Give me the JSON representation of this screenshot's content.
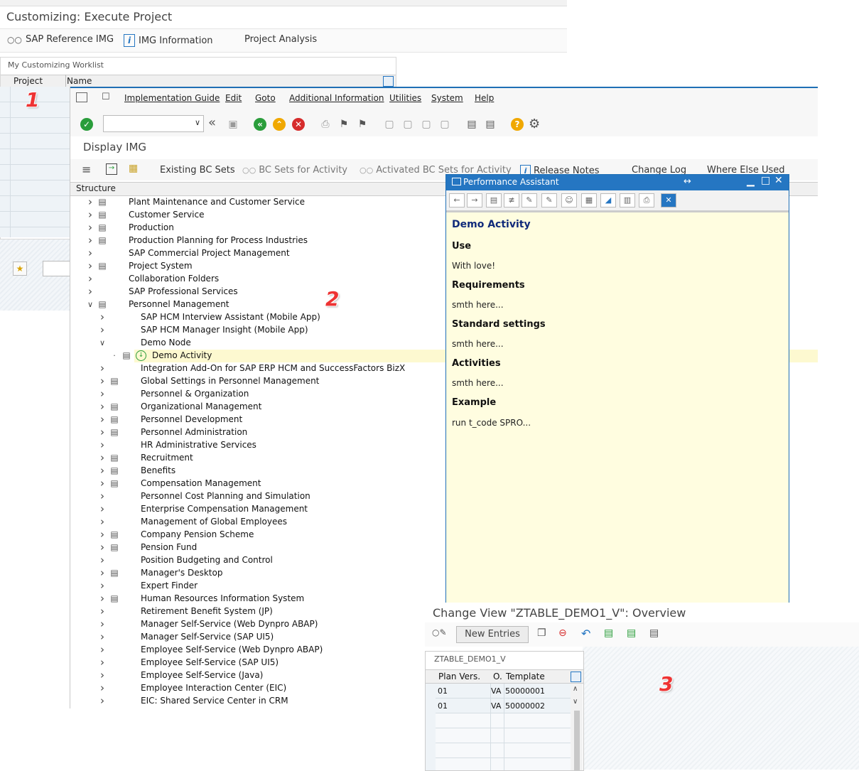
{
  "back_window": {
    "title": "Customizing: Execute Project",
    "app_buttons": [
      "SAP Reference IMG",
      "IMG Information",
      "Project Analysis"
    ],
    "worklist_caption": "My Customizing Worklist",
    "columns": [
      "Project",
      "Name"
    ]
  },
  "annotations": [
    "1",
    "2",
    "3"
  ],
  "img_window": {
    "menu": [
      "Implementation Guide",
      "Edit",
      "Goto",
      "Additional Information",
      "Utilities",
      "System",
      "Help"
    ],
    "title": "Display IMG",
    "app_buttons": [
      "Existing BC Sets",
      "BC Sets for Activity",
      "Activated BC Sets for Activity",
      "Release Notes",
      "Change Log",
      "Where Else Used"
    ],
    "structure_label": "Structure",
    "tree": [
      {
        "label": "Plant Maintenance and Customer Service",
        "level": 0,
        "doc": true,
        "chev": "right"
      },
      {
        "label": "Customer Service",
        "level": 0,
        "doc": true,
        "chev": "right"
      },
      {
        "label": "Production",
        "level": 0,
        "doc": true,
        "chev": "right"
      },
      {
        "label": "Production Planning for Process Industries",
        "level": 0,
        "doc": true,
        "chev": "right"
      },
      {
        "label": "SAP Commercial Project Management",
        "level": 0,
        "doc": false,
        "chev": "right"
      },
      {
        "label": "Project System",
        "level": 0,
        "doc": true,
        "chev": "right"
      },
      {
        "label": "Collaboration Folders",
        "level": 0,
        "doc": false,
        "chev": "right"
      },
      {
        "label": "SAP Professional Services",
        "level": 0,
        "doc": false,
        "chev": "right"
      },
      {
        "label": "Personnel Management",
        "level": 0,
        "doc": true,
        "chev": "down"
      },
      {
        "label": "SAP HCM Interview Assistant (Mobile App)",
        "level": 1,
        "doc": false,
        "chev": "right"
      },
      {
        "label": "SAP HCM Manager Insight (Mobile App)",
        "level": 1,
        "doc": false,
        "chev": "right"
      },
      {
        "label": "Demo Node",
        "level": 1,
        "doc": false,
        "chev": "down"
      },
      {
        "label": "Demo Activity",
        "level": 2,
        "doc": true,
        "chev": "dot"
      },
      {
        "label": "Integration Add-On for SAP ERP HCM and SuccessFactors BizX",
        "level": 1,
        "doc": false,
        "chev": "right"
      },
      {
        "label": "Global Settings in Personnel Management",
        "level": 1,
        "doc": true,
        "chev": "right"
      },
      {
        "label": "Personnel & Organization",
        "level": 1,
        "doc": false,
        "chev": "right"
      },
      {
        "label": "Organizational Management",
        "level": 1,
        "doc": true,
        "chev": "right"
      },
      {
        "label": "Personnel Development",
        "level": 1,
        "doc": true,
        "chev": "right"
      },
      {
        "label": "Personnel Administration",
        "level": 1,
        "doc": true,
        "chev": "right"
      },
      {
        "label": "HR Administrative Services",
        "level": 1,
        "doc": false,
        "chev": "right"
      },
      {
        "label": "Recruitment",
        "level": 1,
        "doc": true,
        "chev": "right"
      },
      {
        "label": "Benefits",
        "level": 1,
        "doc": true,
        "chev": "right"
      },
      {
        "label": "Compensation Management",
        "level": 1,
        "doc": true,
        "chev": "right"
      },
      {
        "label": "Personnel Cost Planning and Simulation",
        "level": 1,
        "doc": false,
        "chev": "right"
      },
      {
        "label": "Enterprise Compensation Management",
        "level": 1,
        "doc": false,
        "chev": "right"
      },
      {
        "label": "Management of Global Employees",
        "level": 1,
        "doc": false,
        "chev": "right"
      },
      {
        "label": "Company Pension Scheme",
        "level": 1,
        "doc": true,
        "chev": "right"
      },
      {
        "label": "Pension Fund",
        "level": 1,
        "doc": true,
        "chev": "right"
      },
      {
        "label": "Position Budgeting and Control",
        "level": 1,
        "doc": false,
        "chev": "right"
      },
      {
        "label": "Manager's Desktop",
        "level": 1,
        "doc": true,
        "chev": "right"
      },
      {
        "label": "Expert Finder",
        "level": 1,
        "doc": false,
        "chev": "right"
      },
      {
        "label": "Human Resources Information System",
        "level": 1,
        "doc": true,
        "chev": "right"
      },
      {
        "label": "Retirement Benefit System (JP)",
        "level": 1,
        "doc": false,
        "chev": "right"
      },
      {
        "label": "Manager Self-Service (Web Dynpro ABAP)",
        "level": 1,
        "doc": false,
        "chev": "right"
      },
      {
        "label": "Manager Self-Service (SAP UI5)",
        "level": 1,
        "doc": false,
        "chev": "right"
      },
      {
        "label": "Employee Self-Service (Web Dynpro ABAP)",
        "level": 1,
        "doc": false,
        "chev": "right"
      },
      {
        "label": "Employee Self-Service (SAP UI5)",
        "level": 1,
        "doc": false,
        "chev": "right"
      },
      {
        "label": "Employee Self-Service (Java)",
        "level": 1,
        "doc": false,
        "chev": "right"
      },
      {
        "label": "Employee Interaction Center (EIC)",
        "level": 1,
        "doc": false,
        "chev": "right"
      },
      {
        "label": "EIC: Shared Service Center in CRM",
        "level": 1,
        "doc": false,
        "chev": "right"
      }
    ]
  },
  "assistant": {
    "title": "Performance Assistant",
    "heading": "Demo Activity",
    "sections": [
      {
        "head": "Use",
        "text": "With love!"
      },
      {
        "head": "Requirements",
        "text": "smth here..."
      },
      {
        "head": "Standard settings",
        "text": "smth here..."
      },
      {
        "head": "Activities",
        "text": "smth here..."
      },
      {
        "head": "Example",
        "text": "run t_code SPRO..."
      }
    ]
  },
  "change_view": {
    "title": "Change View \"ZTABLE_DEMO1_V\": Overview",
    "new_entries": "New Entries",
    "table_caption": "ZTABLE_DEMO1_V",
    "columns": [
      "Plan Vers.",
      "O.",
      "Template"
    ],
    "rows": [
      [
        "01",
        "VA",
        "50000001"
      ],
      [
        "01",
        "VA",
        "50000002"
      ]
    ]
  },
  "colors": {
    "sap_blue": "#2576c2",
    "highlight": "#fdf9d0",
    "assistant_bg": "#fffde0",
    "annotation_red": "#e33333"
  }
}
